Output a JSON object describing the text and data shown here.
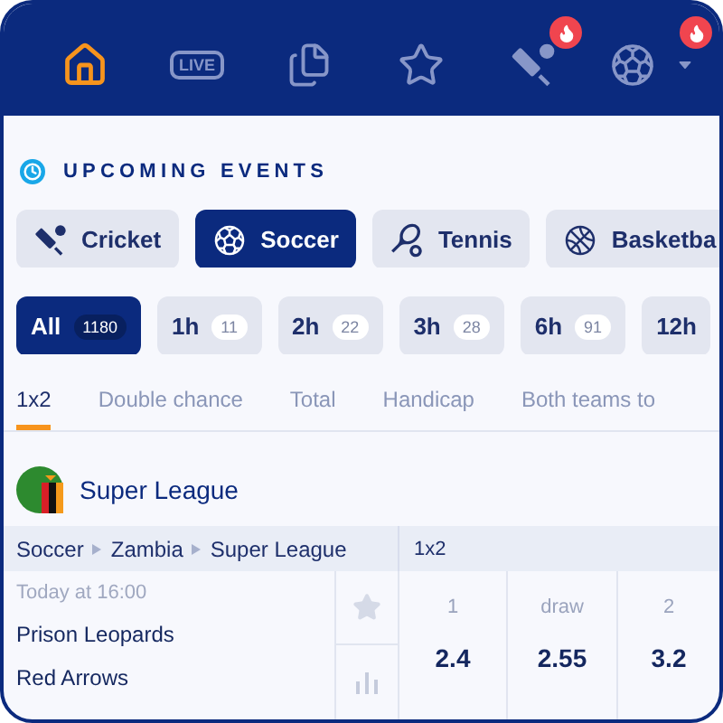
{
  "nav": [
    {
      "kind": "home",
      "selected": true
    },
    {
      "kind": "live",
      "label": "LIVE",
      "selected": false
    },
    {
      "kind": "coupon",
      "selected": false
    },
    {
      "kind": "favorites",
      "selected": false
    },
    {
      "kind": "cricket",
      "selected": false,
      "hot": true
    },
    {
      "kind": "soccer",
      "selected": false,
      "hot": true,
      "dropdown": true
    }
  ],
  "section_title": "UPCOMING EVENTS",
  "sports": [
    {
      "kind": "cricket",
      "label": "Cricket",
      "selected": false
    },
    {
      "kind": "soccer",
      "label": "Soccer",
      "selected": true
    },
    {
      "kind": "tennis",
      "label": "Tennis",
      "selected": false
    },
    {
      "kind": "basketball",
      "label": "Basketba",
      "selected": false
    }
  ],
  "time_filters": [
    {
      "label": "All",
      "count": "1180",
      "selected": true
    },
    {
      "label": "1h",
      "count": "11",
      "selected": false
    },
    {
      "label": "2h",
      "count": "22",
      "selected": false
    },
    {
      "label": "3h",
      "count": "28",
      "selected": false
    },
    {
      "label": "6h",
      "count": "91",
      "selected": false
    },
    {
      "label": "12h",
      "selected": false
    }
  ],
  "markets": [
    {
      "label": "1x2",
      "selected": true
    },
    {
      "label": "Double chance",
      "selected": false
    },
    {
      "label": "Total",
      "selected": false
    },
    {
      "label": "Handicap",
      "selected": false
    },
    {
      "label": "Both teams to",
      "selected": false
    }
  ],
  "league": {
    "name": "Super League",
    "breadcrumb": [
      "Soccer",
      "Zambia",
      "Super League"
    ],
    "market": "1x2"
  },
  "match": {
    "time": "Today at 16:00",
    "home": "Prison Leopards",
    "away": "Red Arrows",
    "favorite": false,
    "odds": [
      {
        "label": "1",
        "value": "2.4"
      },
      {
        "label": "draw",
        "value": "2.55"
      },
      {
        "label": "2",
        "value": "3.2"
      }
    ]
  }
}
